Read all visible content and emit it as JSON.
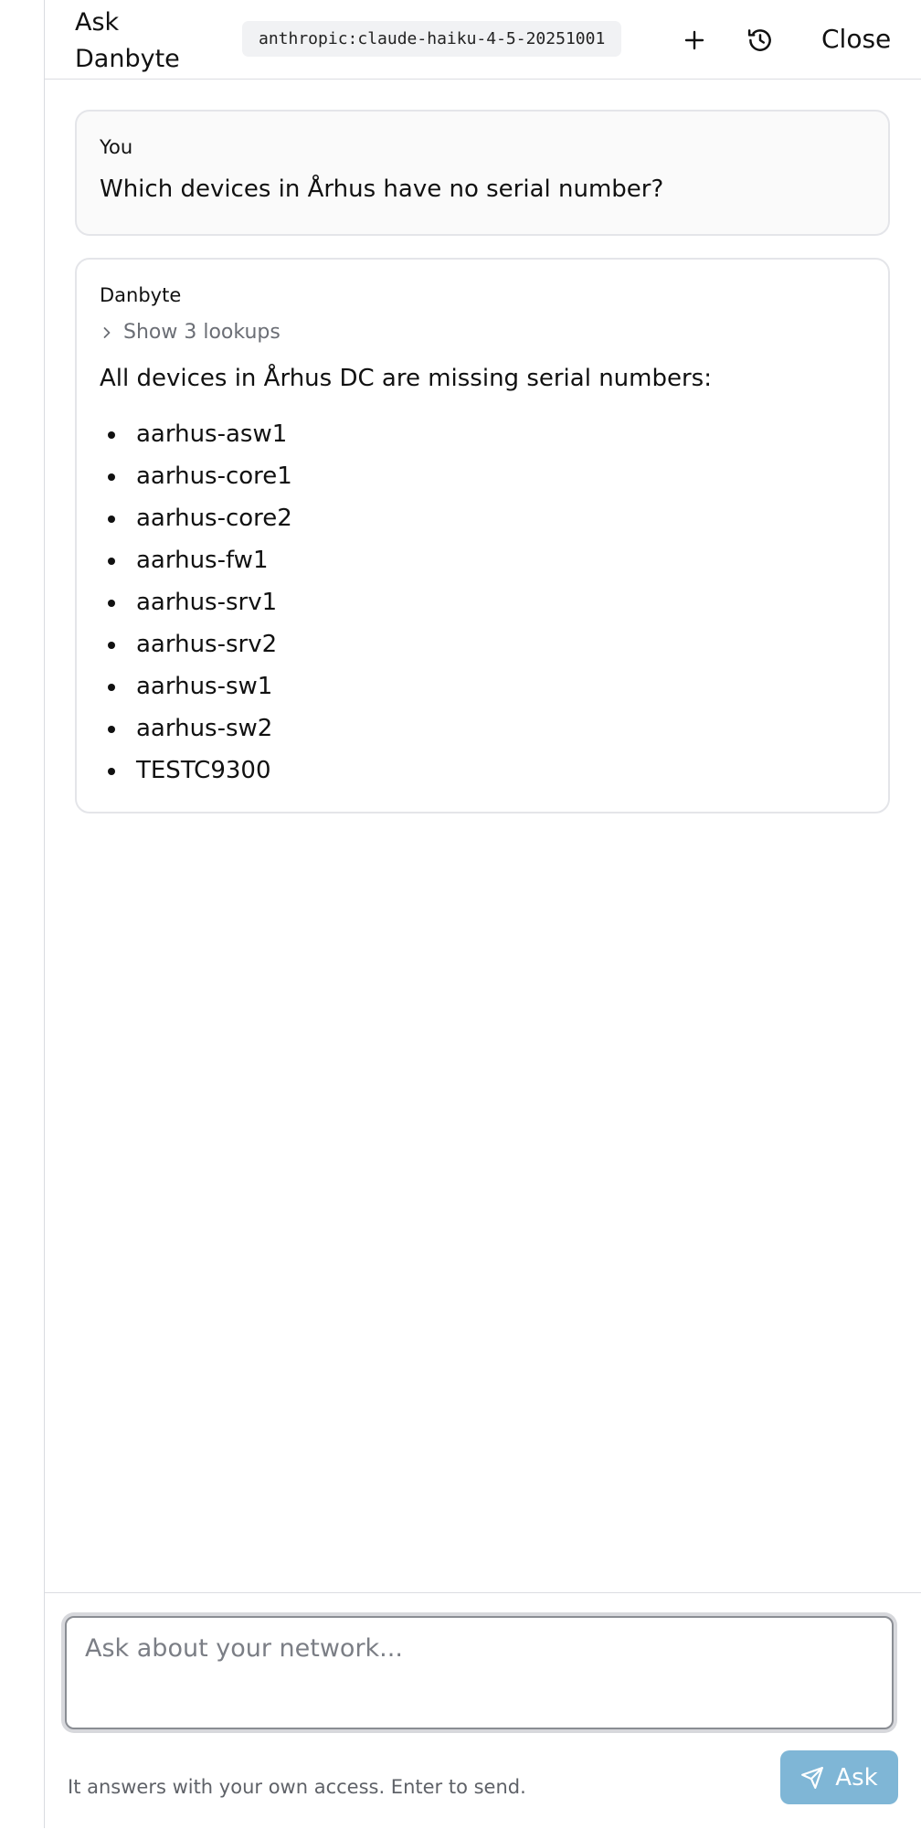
{
  "header": {
    "title": "Ask Danbyte",
    "model": "anthropic:claude-haiku-4-5-20251001",
    "new_chat_icon": "plus-icon",
    "history_icon": "history-icon",
    "close_label": "Close"
  },
  "conversation": {
    "user_message": {
      "author": "You",
      "text": "Which devices in Århus have no serial number?"
    },
    "assistant_message": {
      "author": "Danbyte",
      "lookups_label": "Show 3 lookups",
      "lookups_icon": "chevron-right-icon",
      "text": "All devices in Århus DC are missing serial numbers:",
      "devices": [
        "aarhus-asw1",
        "aarhus-core1",
        "aarhus-core2",
        "aarhus-fw1",
        "aarhus-srv1",
        "aarhus-srv2",
        "aarhus-sw1",
        "aarhus-sw2",
        "TESTC9300"
      ]
    }
  },
  "composer": {
    "placeholder": "Ask about your network...",
    "value": "",
    "hint": "It answers with your own access. Enter to send.",
    "ask_label": "Ask",
    "ask_icon": "send-icon",
    "ask_color": "#7fb6d6"
  }
}
